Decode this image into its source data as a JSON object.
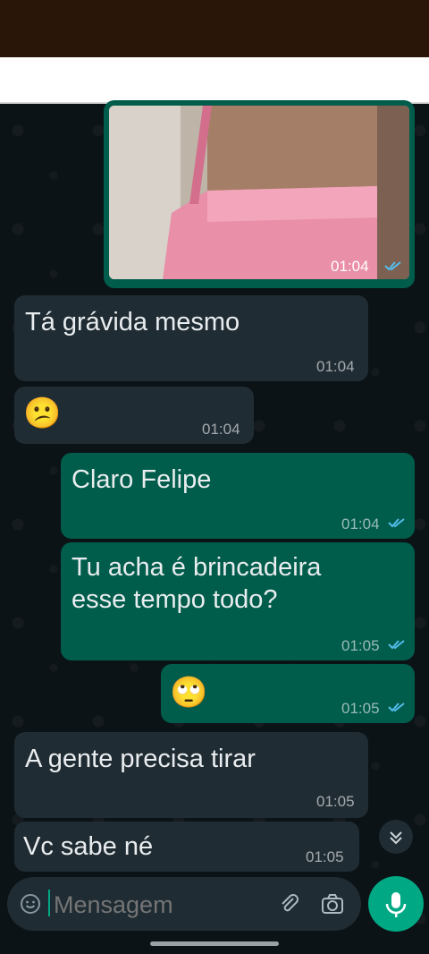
{
  "image_message": {
    "time": "01:04"
  },
  "messages": [
    {
      "text": "Tá grávida mesmo",
      "time": "01:04"
    },
    {
      "text": "😕",
      "time": "01:04"
    },
    {
      "text": "Claro Felipe",
      "time": "01:04"
    },
    {
      "text": "Tu acha é brincadeira\nesse tempo todo?",
      "time": "01:05"
    },
    {
      "text": "🙄",
      "time": "01:05"
    },
    {
      "text": "A gente precisa tirar",
      "time": "01:05"
    },
    {
      "text": "Vc sabe né",
      "time": "01:05"
    }
  ],
  "composer": {
    "placeholder": "Mensagem"
  },
  "colors": {
    "incoming": "#202c33",
    "outgoing": "#005c4b",
    "accent": "#00a884",
    "read_ticks": "#53bdeb"
  }
}
